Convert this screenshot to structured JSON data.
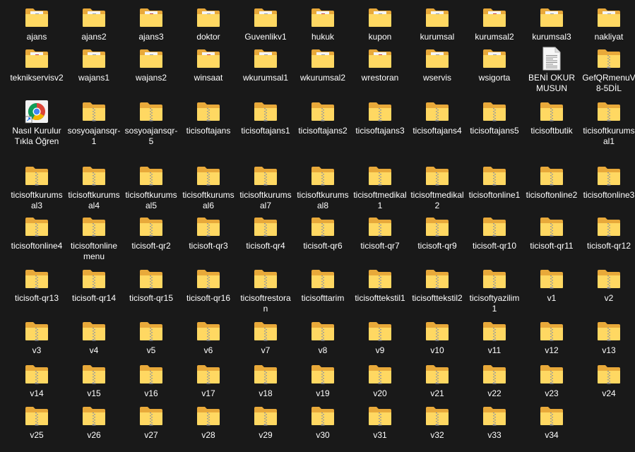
{
  "desktop": {
    "items": [
      {
        "label": "ajans",
        "kind": "folder-doc-icon"
      },
      {
        "label": "ajans2",
        "kind": "folder-doc-icon"
      },
      {
        "label": "ajans3",
        "kind": "folder-doc-icon"
      },
      {
        "label": "doktor",
        "kind": "folder-doc-icon"
      },
      {
        "label": "Guvenlikv1",
        "kind": "folder-doc-icon"
      },
      {
        "label": "hukuk",
        "kind": "folder-doc-icon"
      },
      {
        "label": "kupon",
        "kind": "folder-doc-icon"
      },
      {
        "label": "kurumsal",
        "kind": "folder-doc-icon"
      },
      {
        "label": "kurumsal2",
        "kind": "folder-doc-icon"
      },
      {
        "label": "kurumsal3",
        "kind": "folder-doc-icon"
      },
      {
        "label": "nakliyat",
        "kind": "folder-doc-icon"
      },
      {
        "label": "teknikservisv2",
        "kind": "folder-doc-icon"
      },
      {
        "label": "wajans1",
        "kind": "folder-doc-icon"
      },
      {
        "label": "wajans2",
        "kind": "folder-doc-icon"
      },
      {
        "label": "winsaat",
        "kind": "folder-doc-icon"
      },
      {
        "label": "wkurumsal1",
        "kind": "folder-doc-icon"
      },
      {
        "label": "wkurumsal2",
        "kind": "folder-doc-icon"
      },
      {
        "label": "wrestoran",
        "kind": "folder-doc-icon"
      },
      {
        "label": "wservis",
        "kind": "folder-doc-icon"
      },
      {
        "label": "wsigorta",
        "kind": "folder-doc-icon"
      },
      {
        "label": "BENİ OKUR MUSUN",
        "kind": "text-file-icon"
      },
      {
        "label": "GefQRmenuV8-5DİL",
        "kind": "zip-folder-icon"
      },
      {
        "label": "Nasıl Kurulur Tıkla Öğren",
        "kind": "chrome-shortcut-icon"
      },
      {
        "label": "sosyoajansqr-1",
        "kind": "zip-folder-icon"
      },
      {
        "label": "sosyoajansqr-5",
        "kind": "zip-folder-icon"
      },
      {
        "label": "ticisoftajans",
        "kind": "zip-folder-icon"
      },
      {
        "label": "ticisoftajans1",
        "kind": "zip-folder-icon"
      },
      {
        "label": "ticisoftajans2",
        "kind": "zip-folder-icon"
      },
      {
        "label": "ticisoftajans3",
        "kind": "zip-folder-icon"
      },
      {
        "label": "ticisoftajans4",
        "kind": "zip-folder-icon"
      },
      {
        "label": "ticisoftajans5",
        "kind": "zip-folder-icon"
      },
      {
        "label": "ticisoftbutik",
        "kind": "zip-folder-icon"
      },
      {
        "label": "ticisoftkurumsal1",
        "kind": "zip-folder-icon"
      },
      {
        "label": "ticisoftkurumsal3",
        "kind": "zip-folder-icon"
      },
      {
        "label": "ticisoftkurumsal4",
        "kind": "zip-folder-icon"
      },
      {
        "label": "ticisoftkurumsal5",
        "kind": "zip-folder-icon"
      },
      {
        "label": "ticisoftkurumsal6",
        "kind": "zip-folder-icon"
      },
      {
        "label": "ticisoftkurumsal7",
        "kind": "zip-folder-icon"
      },
      {
        "label": "ticisoftkurumsal8",
        "kind": "zip-folder-icon"
      },
      {
        "label": "ticisoftmedikal1",
        "kind": "zip-folder-icon"
      },
      {
        "label": "ticisoftmedikal2",
        "kind": "zip-folder-icon"
      },
      {
        "label": "ticisoftonline1",
        "kind": "zip-folder-icon"
      },
      {
        "label": "ticisoftonline2",
        "kind": "zip-folder-icon"
      },
      {
        "label": "ticisoftonline3",
        "kind": "zip-folder-icon"
      },
      {
        "label": "ticisoftonline4",
        "kind": "zip-folder-icon"
      },
      {
        "label": "ticisoftonlinemenu",
        "kind": "zip-folder-icon"
      },
      {
        "label": "ticisoft-qr2",
        "kind": "zip-folder-icon"
      },
      {
        "label": "ticisoft-qr3",
        "kind": "zip-folder-icon"
      },
      {
        "label": "ticisoft-qr4",
        "kind": "zip-folder-icon"
      },
      {
        "label": "ticisoft-qr6",
        "kind": "zip-folder-icon"
      },
      {
        "label": "ticisoft-qr7",
        "kind": "zip-folder-icon"
      },
      {
        "label": "ticisoft-qr9",
        "kind": "zip-folder-icon"
      },
      {
        "label": "ticisoft-qr10",
        "kind": "zip-folder-icon"
      },
      {
        "label": "ticisoft-qr11",
        "kind": "zip-folder-icon"
      },
      {
        "label": "ticisoft-qr12",
        "kind": "zip-folder-icon"
      },
      {
        "label": "ticisoft-qr13",
        "kind": "zip-folder-icon"
      },
      {
        "label": "ticisoft-qr14",
        "kind": "zip-folder-icon"
      },
      {
        "label": "ticisoft-qr15",
        "kind": "zip-folder-icon"
      },
      {
        "label": "ticisoft-qr16",
        "kind": "zip-folder-icon"
      },
      {
        "label": "ticisoftrestoran",
        "kind": "zip-folder-icon"
      },
      {
        "label": "ticisofttarim",
        "kind": "zip-folder-icon"
      },
      {
        "label": "ticisofttekstil1",
        "kind": "zip-folder-icon"
      },
      {
        "label": "ticisofttekstil2",
        "kind": "zip-folder-icon"
      },
      {
        "label": "ticisoftyazilim1",
        "kind": "zip-folder-icon"
      },
      {
        "label": "v1",
        "kind": "zip-folder-icon"
      },
      {
        "label": "v2",
        "kind": "zip-folder-icon"
      },
      {
        "label": "v3",
        "kind": "zip-folder-icon"
      },
      {
        "label": "v4",
        "kind": "zip-folder-icon"
      },
      {
        "label": "v5",
        "kind": "zip-folder-icon"
      },
      {
        "label": "v6",
        "kind": "zip-folder-icon"
      },
      {
        "label": "v7",
        "kind": "zip-folder-icon"
      },
      {
        "label": "v8",
        "kind": "zip-folder-icon"
      },
      {
        "label": "v9",
        "kind": "zip-folder-icon"
      },
      {
        "label": "v10",
        "kind": "zip-folder-icon"
      },
      {
        "label": "v11",
        "kind": "zip-folder-icon"
      },
      {
        "label": "v12",
        "kind": "zip-folder-icon"
      },
      {
        "label": "v13",
        "kind": "zip-folder-icon"
      },
      {
        "label": "v14",
        "kind": "zip-folder-icon"
      },
      {
        "label": "v15",
        "kind": "zip-folder-icon"
      },
      {
        "label": "v16",
        "kind": "zip-folder-icon"
      },
      {
        "label": "v17",
        "kind": "zip-folder-icon"
      },
      {
        "label": "v18",
        "kind": "zip-folder-icon"
      },
      {
        "label": "v19",
        "kind": "zip-folder-icon"
      },
      {
        "label": "v20",
        "kind": "zip-folder-icon"
      },
      {
        "label": "v21",
        "kind": "zip-folder-icon"
      },
      {
        "label": "v22",
        "kind": "zip-folder-icon"
      },
      {
        "label": "v23",
        "kind": "zip-folder-icon"
      },
      {
        "label": "v24",
        "kind": "zip-folder-icon"
      },
      {
        "label": "v25",
        "kind": "zip-folder-icon"
      },
      {
        "label": "v26",
        "kind": "zip-folder-icon"
      },
      {
        "label": "v27",
        "kind": "zip-folder-icon"
      },
      {
        "label": "v28",
        "kind": "zip-folder-icon"
      },
      {
        "label": "v29",
        "kind": "zip-folder-icon"
      },
      {
        "label": "v30",
        "kind": "zip-folder-icon"
      },
      {
        "label": "v31",
        "kind": "zip-folder-icon"
      },
      {
        "label": "v32",
        "kind": "zip-folder-icon"
      },
      {
        "label": "v33",
        "kind": "zip-folder-icon"
      },
      {
        "label": "v34",
        "kind": "zip-folder-icon"
      }
    ]
  },
  "colors": {
    "background": "#191919",
    "folder_back": "#E8A93A",
    "folder_front": "#FFD862",
    "zipper": "#9a9a9a",
    "label": "#ffffff"
  }
}
